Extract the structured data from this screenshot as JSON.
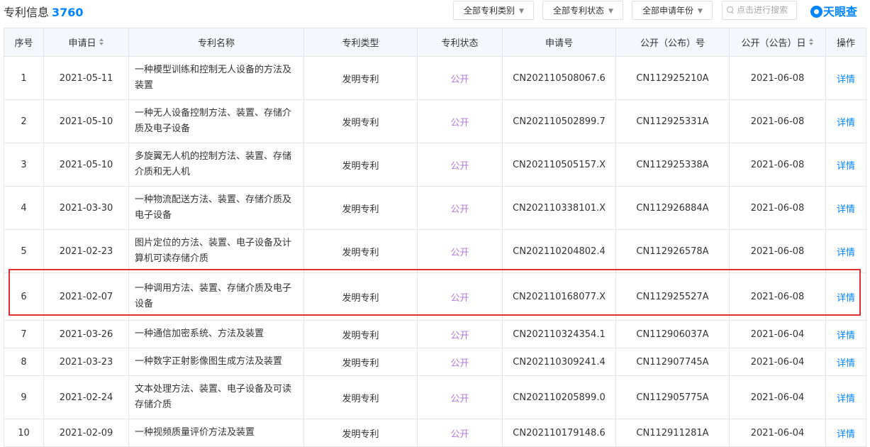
{
  "header": {
    "title": "专利信息",
    "count": "3760",
    "filters": [
      "全部专利类别",
      "全部专利状态",
      "全部申请年份"
    ],
    "search_placeholder": "点击进行搜索",
    "logo_text": "天眼查"
  },
  "columns": [
    "序号",
    "申请日",
    "专利名称",
    "专利类型",
    "专利状态",
    "申请号",
    "公开（公布）号",
    "公开（公告）日",
    "操作"
  ],
  "rows": [
    {
      "no": "1",
      "date": "2021-05-11",
      "name": "一种模型训练和控制无人设备的方法及装置",
      "type": "发明专利",
      "status": "公开",
      "app_no": "CN202110508067.6",
      "pub_no": "CN112925210A",
      "pub_date": "2021-06-08",
      "op": "详情"
    },
    {
      "no": "2",
      "date": "2021-05-10",
      "name": "一种无人设备控制方法、装置、存储介质及电子设备",
      "type": "发明专利",
      "status": "公开",
      "app_no": "CN202110502899.7",
      "pub_no": "CN112925331A",
      "pub_date": "2021-06-08",
      "op": "详情"
    },
    {
      "no": "3",
      "date": "2021-05-10",
      "name": "多旋翼无人机的控制方法、装置、存储介质和无人机",
      "type": "发明专利",
      "status": "公开",
      "app_no": "CN202110505157.X",
      "pub_no": "CN112925338A",
      "pub_date": "2021-06-08",
      "op": "详情"
    },
    {
      "no": "4",
      "date": "2021-03-30",
      "name": "一种物流配送方法、装置、存储介质及电子设备",
      "type": "发明专利",
      "status": "公开",
      "app_no": "CN202110338101.X",
      "pub_no": "CN112926884A",
      "pub_date": "2021-06-08",
      "op": "详情"
    },
    {
      "no": "5",
      "date": "2021-02-23",
      "name": "图片定位的方法、装置、电子设备及计算机可读存储介质",
      "type": "发明专利",
      "status": "公开",
      "app_no": "CN202110204802.4",
      "pub_no": "CN112926578A",
      "pub_date": "2021-06-08",
      "op": "详情"
    },
    {
      "no": "6",
      "date": "2021-02-07",
      "name": "一种调用方法、装置、存储介质及电子设备",
      "type": "发明专利",
      "status": "公开",
      "app_no": "CN202110168077.X",
      "pub_no": "CN112925527A",
      "pub_date": "2021-06-08",
      "op": "详情"
    },
    {
      "no": "7",
      "date": "2021-03-26",
      "name": "一种通信加密系统、方法及装置",
      "type": "发明专利",
      "status": "公开",
      "app_no": "CN202110324354.1",
      "pub_no": "CN112906037A",
      "pub_date": "2021-06-04",
      "op": "详情"
    },
    {
      "no": "8",
      "date": "2021-03-23",
      "name": "一种数字正射影像图生成方法及装置",
      "type": "发明专利",
      "status": "公开",
      "app_no": "CN202110309241.4",
      "pub_no": "CN112907745A",
      "pub_date": "2021-06-04",
      "op": "详情"
    },
    {
      "no": "9",
      "date": "2021-02-24",
      "name": "文本处理方法、装置、电子设备及可读存储介质",
      "type": "发明专利",
      "status": "公开",
      "app_no": "CN202110205899.0",
      "pub_no": "CN112905775A",
      "pub_date": "2021-06-04",
      "op": "详情"
    },
    {
      "no": "10",
      "date": "2021-02-09",
      "name": "一种视频质量评价方法及装置",
      "type": "发明专利",
      "status": "公开",
      "app_no": "CN202110179148.6",
      "pub_no": "CN112911281A",
      "pub_date": "2021-06-04",
      "op": "详情"
    }
  ],
  "colors": {
    "accent": "#0084ff",
    "status": "#b07ad9",
    "highlight": "#e03131",
    "header_bg": "#f4f7fc"
  }
}
